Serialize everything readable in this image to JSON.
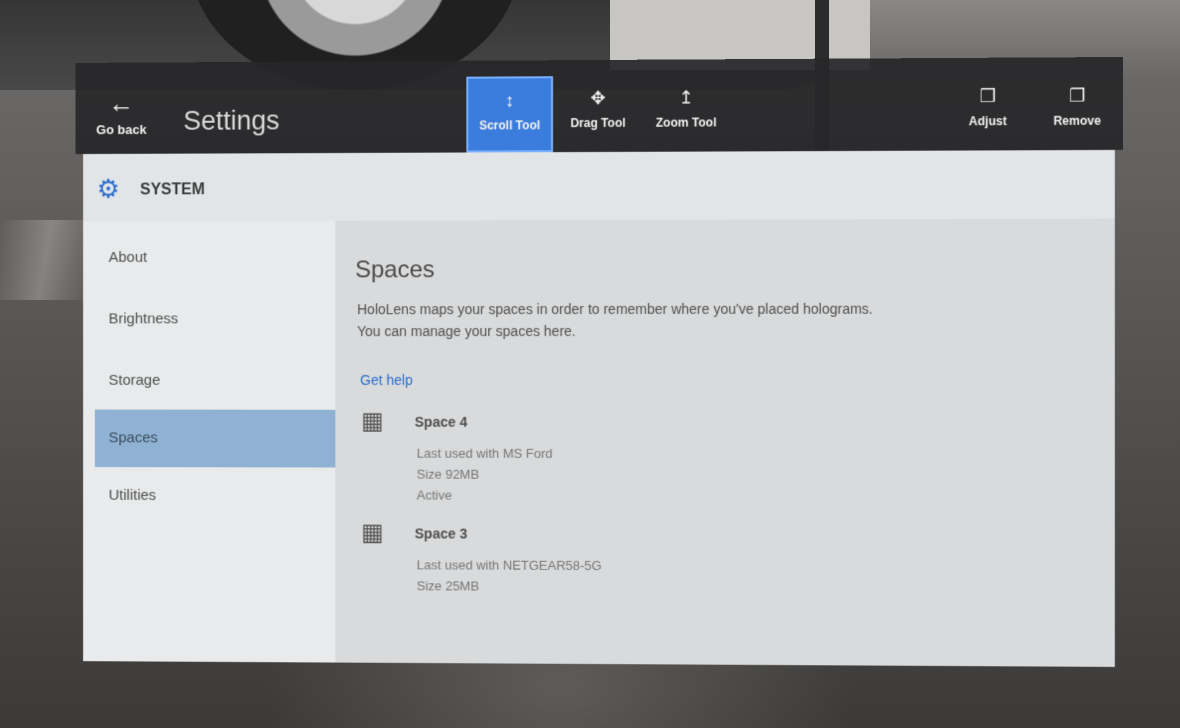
{
  "toolbar": {
    "back_label": "Go back",
    "title": "Settings",
    "tools": [
      {
        "label": "Scroll Tool",
        "icon": "scroll-icon",
        "active": true
      },
      {
        "label": "Drag Tool",
        "icon": "drag-icon",
        "active": false
      },
      {
        "label": "Zoom Tool",
        "icon": "zoom-icon",
        "active": false
      }
    ],
    "adjust_label": "Adjust",
    "remove_label": "Remove"
  },
  "header": {
    "label": "SYSTEM",
    "icon": "gear-icon"
  },
  "nav": {
    "items": [
      {
        "label": "About"
      },
      {
        "label": "Brightness"
      },
      {
        "label": "Storage"
      },
      {
        "label": "Spaces"
      },
      {
        "label": "Utilities"
      }
    ],
    "selected": "Spaces"
  },
  "content": {
    "title": "Spaces",
    "description": "HoloLens maps your spaces in order to remember where you've placed holograms. You can manage your spaces here.",
    "help_link": "Get help",
    "spaces": [
      {
        "name": "Space 4",
        "last_used": "Last used with MS Ford",
        "size": "Size 92MB",
        "status": "Active"
      },
      {
        "name": "Space 3",
        "last_used": "Last used with NETGEAR58-5G",
        "size": "Size 25MB"
      }
    ]
  },
  "colors": {
    "accent": "#3b7ddd",
    "selected_nav": "#8fb2d4",
    "toolbar_bg": "#262628",
    "link": "#2a6ec8"
  }
}
